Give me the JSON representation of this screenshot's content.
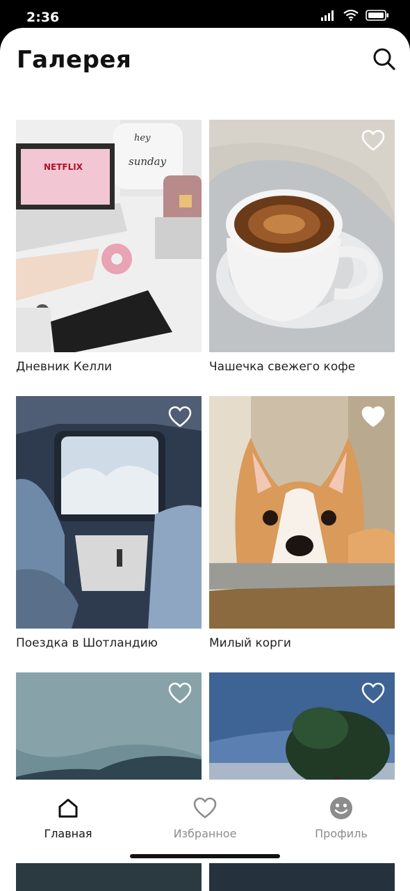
{
  "status_bar": {
    "time": "2:36"
  },
  "header": {
    "title": "Галерея",
    "search_icon": "search-icon"
  },
  "cards": [
    {
      "title": "Дневник Келли",
      "favorite": null
    },
    {
      "title": "Чашечка свежего кофе",
      "favorite": false
    },
    {
      "title": "Поездка в Шотландию",
      "favorite": false
    },
    {
      "title": "Милый корги",
      "favorite": true
    },
    {
      "title": "",
      "favorite": false
    },
    {
      "title": "",
      "favorite": false
    }
  ],
  "tabbar": {
    "tabs": [
      {
        "label": "Главная",
        "icon": "home-icon",
        "active": true
      },
      {
        "label": "Избранное",
        "icon": "heart-icon",
        "active": false
      },
      {
        "label": "Профиль",
        "icon": "smiley-icon",
        "active": false
      }
    ]
  },
  "colors": {
    "text": "#111111",
    "inactive": "#8c8c8c",
    "background": "#ffffff"
  }
}
